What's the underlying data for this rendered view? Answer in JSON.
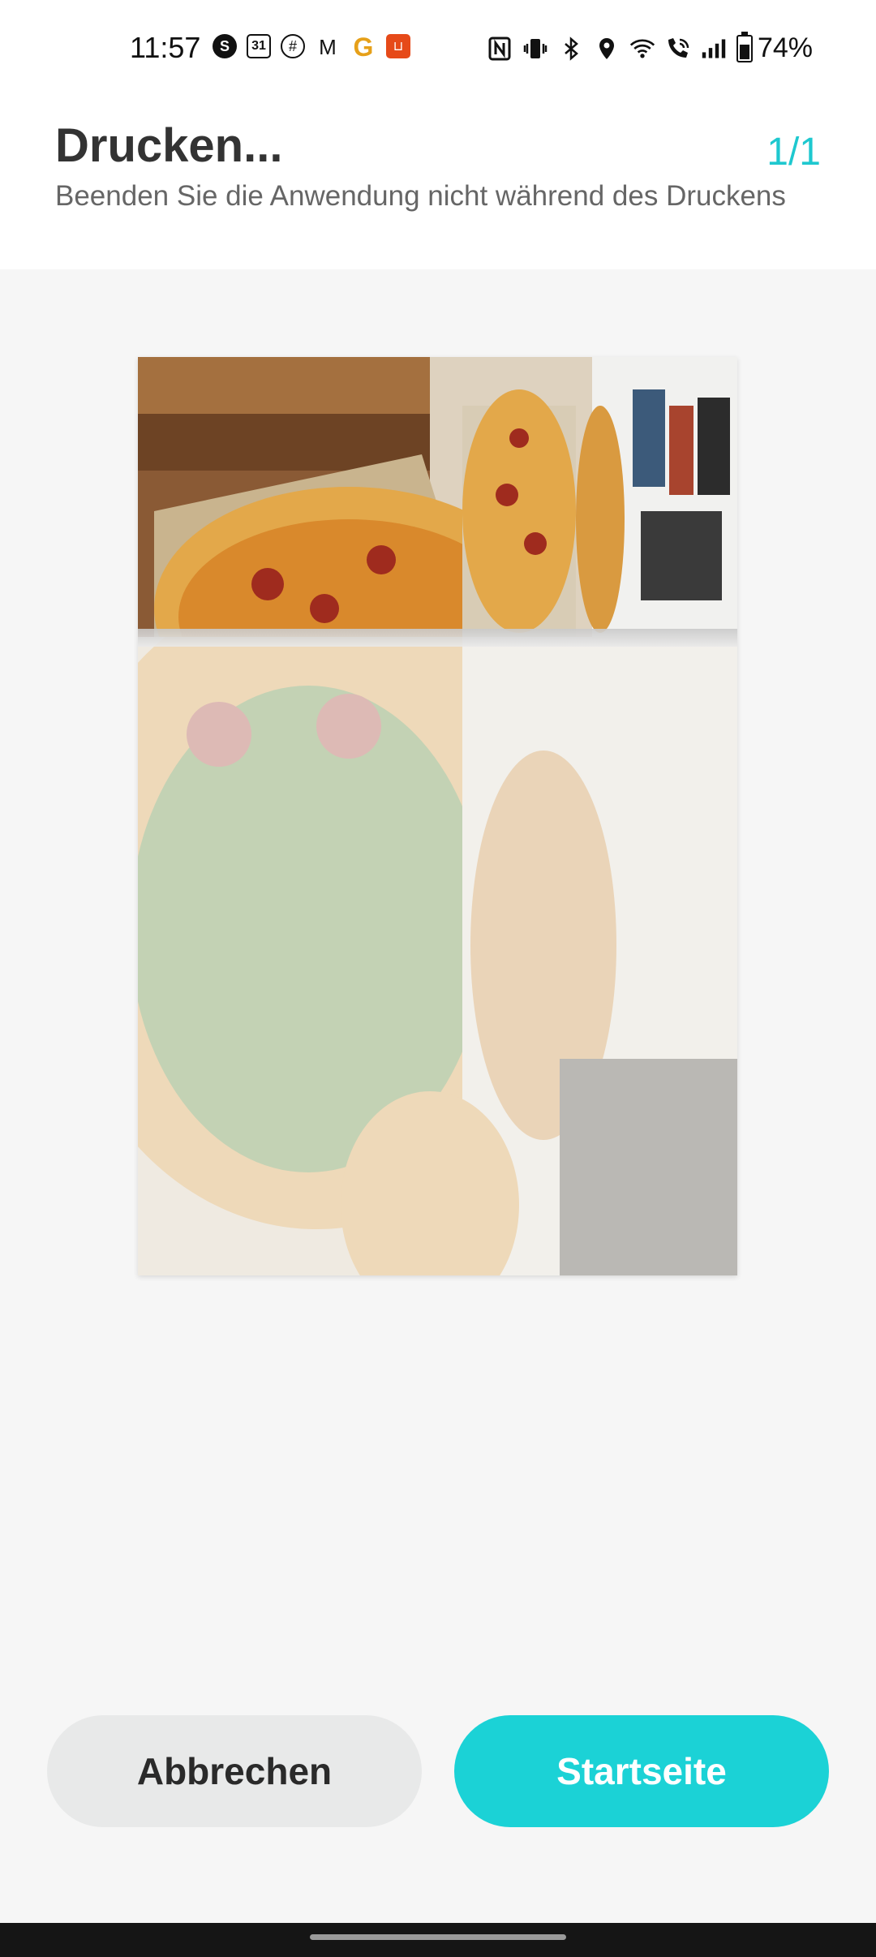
{
  "status_bar": {
    "time": "11:57",
    "notification_icons": [
      "skype-icon",
      "calendar-icon",
      "browser-icon",
      "gmail-icon",
      "google-icon",
      "shop-icon"
    ],
    "calendar_day": "31",
    "status_icons": [
      "nfc-icon",
      "vibrate-icon",
      "bluetooth-icon",
      "location-icon",
      "wifi-icon",
      "wifi-calling-icon",
      "signal-icon"
    ],
    "battery_percent": "74%",
    "battery_level": 0.74
  },
  "header": {
    "title": "Drucken...",
    "subtitle": "Beenden Sie die Anwendung nicht während des Druckens",
    "page_counter": "1/1"
  },
  "preview": {
    "content": "pizza-photo",
    "print_progress": 0.3
  },
  "buttons": {
    "cancel_label": "Abbrechen",
    "home_label": "Startseite"
  },
  "colors": {
    "accent": "#1bd2d6",
    "counter": "#1ec8cf",
    "cancel_bg": "#e8e9e9"
  }
}
